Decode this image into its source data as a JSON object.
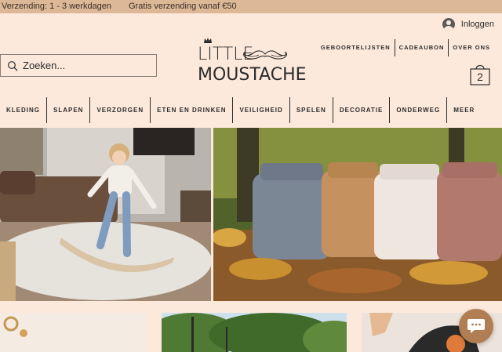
{
  "topbar": {
    "shipping_time": "Verzending: 1 - 3 werkdagen",
    "free_shipping": "Gratis verzending vanaf €50"
  },
  "header": {
    "login_label": "Inloggen",
    "search_placeholder": "Zoeken...",
    "logo_line1": "LITTLE",
    "logo_line2": "MOUSTACHE",
    "links": [
      "GEBOORTELIJSTEN",
      "CADEAUBON",
      "OVER ONS"
    ],
    "cart_count": "2"
  },
  "nav": {
    "items": [
      "KLEDING",
      "SLAPEN",
      "VERZORGEN",
      "ETEN EN DRINKEN",
      "VEILIGHEID",
      "SPELEN",
      "DECORATIE",
      "ONDERWEG",
      "MEER"
    ]
  },
  "colors": {
    "background": "#fde9dc",
    "topbar": "#dcb897",
    "chat_button": "#b07e52"
  },
  "icons": {
    "search": "search-icon",
    "user": "user-icon",
    "cart": "shopping-bag-icon",
    "chat": "chat-icon"
  }
}
